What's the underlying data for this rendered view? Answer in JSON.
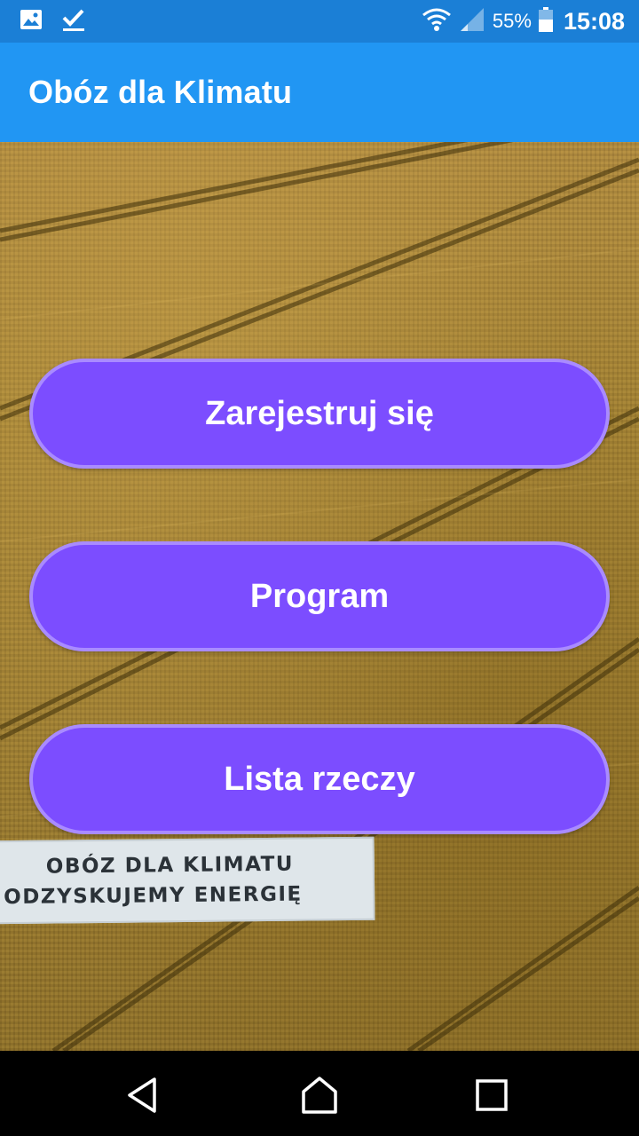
{
  "status_bar": {
    "battery_percent": "55%",
    "time": "15:08",
    "icons": [
      "image-notification-icon",
      "checkmark-notification-icon",
      "wifi-icon",
      "cell-signal-icon",
      "battery-icon"
    ]
  },
  "app_bar": {
    "title": "Obóz dla Klimatu"
  },
  "background_banner": {
    "line1": "OBÓZ DLA KLIMATU",
    "line2": "ODZYSKUJEMY ENERGIĘ"
  },
  "buttons": {
    "register": "Zarejestruj się",
    "program": "Program",
    "checklist": "Lista rzeczy"
  },
  "nav_bar": {
    "icons": [
      "back-icon",
      "home-icon",
      "recents-icon"
    ]
  },
  "colors": {
    "status_bar": "#1b7fd6",
    "app_bar": "#2196f3",
    "button_fill": "#7c4dff",
    "button_border": "#a98bff"
  }
}
